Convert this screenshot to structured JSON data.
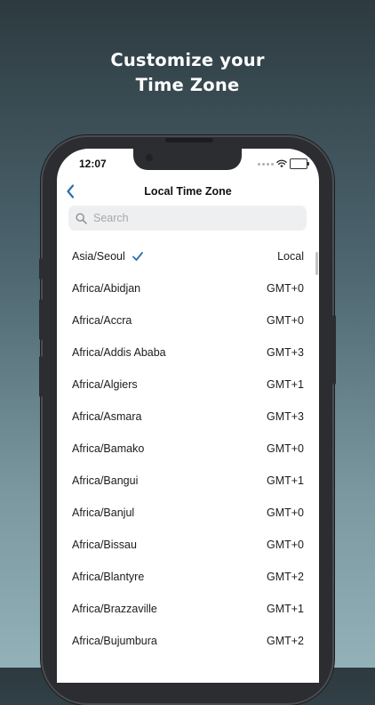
{
  "headline": {
    "line1": "Customize your",
    "line2": "Time Zone"
  },
  "status_bar": {
    "time": "12:07"
  },
  "nav": {
    "title": "Local Time Zone",
    "back_icon": "chevron-left-icon"
  },
  "search": {
    "placeholder": "Search",
    "value": ""
  },
  "colors": {
    "accent": "#2e6fa8",
    "battery": "#34c759"
  },
  "timezones": [
    {
      "name": "Asia/Seoul",
      "offset": "Local",
      "selected": true
    },
    {
      "name": "Africa/Abidjan",
      "offset": "GMT+0"
    },
    {
      "name": "Africa/Accra",
      "offset": "GMT+0"
    },
    {
      "name": "Africa/Addis Ababa",
      "offset": "GMT+3"
    },
    {
      "name": "Africa/Algiers",
      "offset": "GMT+1"
    },
    {
      "name": "Africa/Asmara",
      "offset": "GMT+3"
    },
    {
      "name": "Africa/Bamako",
      "offset": "GMT+0"
    },
    {
      "name": "Africa/Bangui",
      "offset": "GMT+1"
    },
    {
      "name": "Africa/Banjul",
      "offset": "GMT+0"
    },
    {
      "name": "Africa/Bissau",
      "offset": "GMT+0"
    },
    {
      "name": "Africa/Blantyre",
      "offset": "GMT+2"
    },
    {
      "name": "Africa/Brazzaville",
      "offset": "GMT+1"
    },
    {
      "name": "Africa/Bujumbura",
      "offset": "GMT+2"
    }
  ]
}
